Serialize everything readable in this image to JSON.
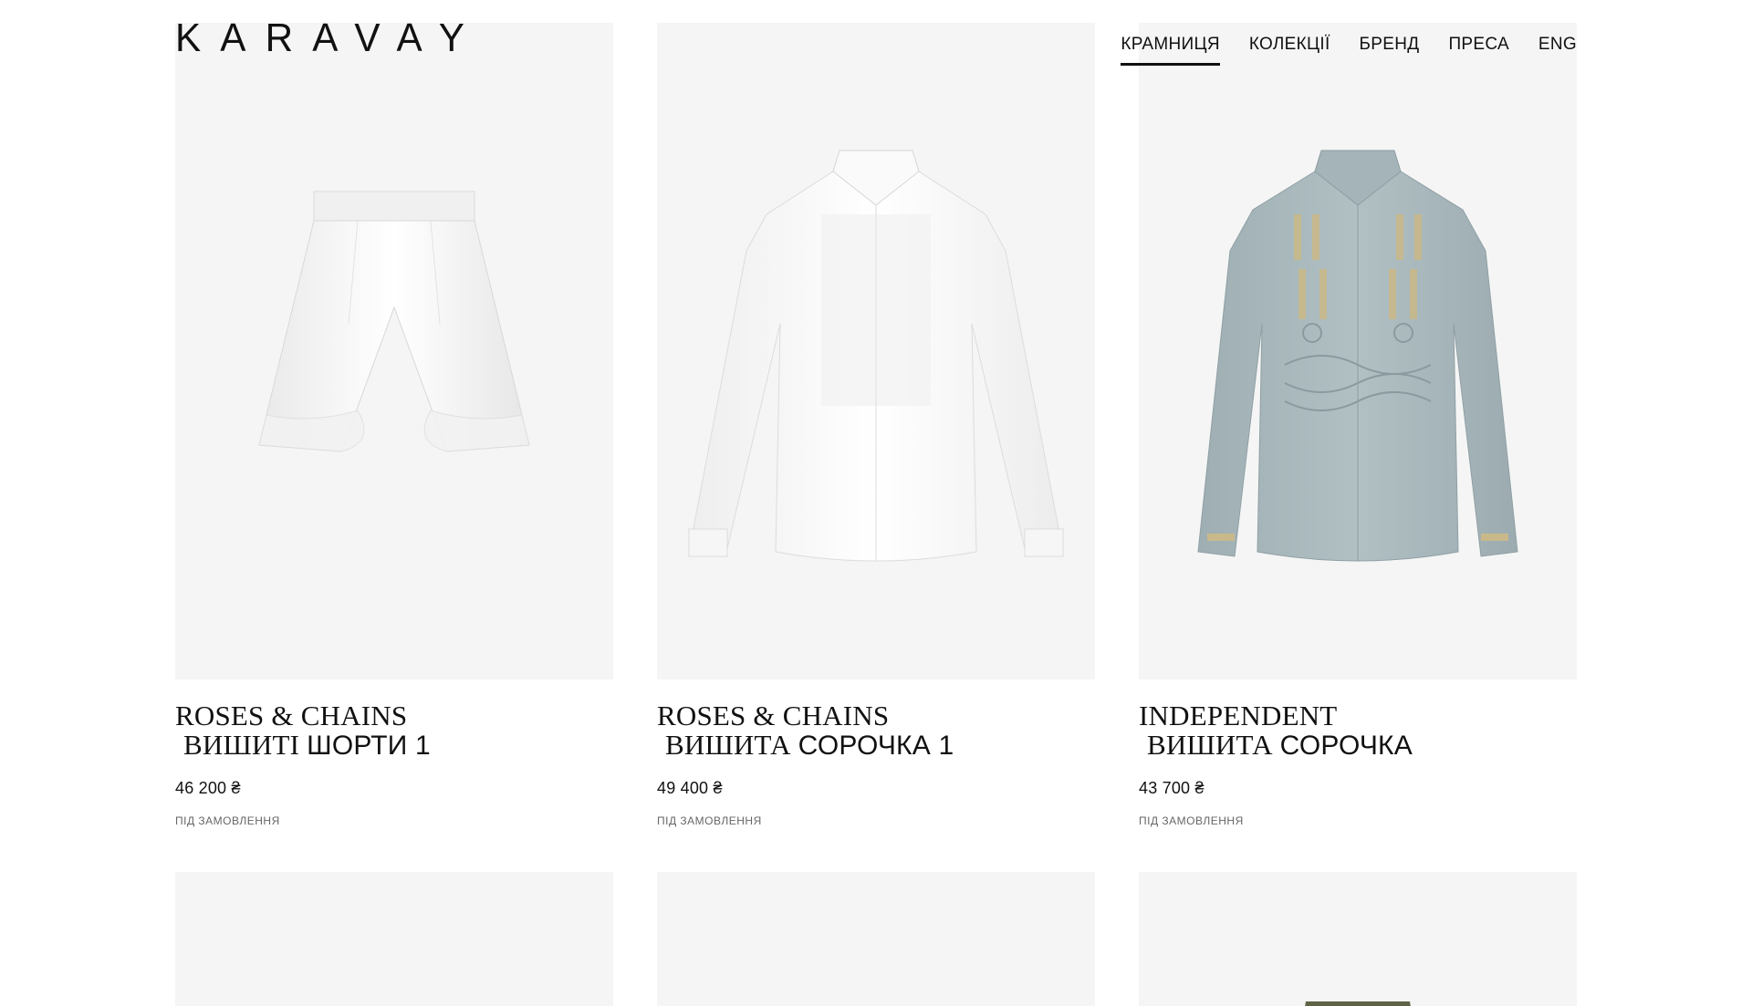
{
  "header": {
    "logo": "KARAVAY",
    "nav": [
      {
        "label": "КРАМНИЦЯ",
        "active": true
      },
      {
        "label": "КОЛЕКЦІЇ",
        "active": false
      },
      {
        "label": "БРЕНД",
        "active": false
      },
      {
        "label": "ПРЕСА",
        "active": false
      },
      {
        "label": "ENG",
        "active": false
      }
    ]
  },
  "products": [
    {
      "collection": "ROSES & CHAINS",
      "title_light": "ВИШИТІ",
      "title_bold": "ШОРТИ 1",
      "price": "46 200 ₴",
      "status": "ПІД ЗАМОВЛЕННЯ",
      "garment": "shorts",
      "color": "#ffffff"
    },
    {
      "collection": "ROSES & CHAINS",
      "title_light": "ВИШИТА",
      "title_bold": "СОРОЧКА 1",
      "price": "49 400 ₴",
      "status": "ПІД ЗАМОВЛЕННЯ",
      "garment": "shirt",
      "color": "#ffffff"
    },
    {
      "collection": "INDEPENDENT",
      "title_light": "ВИШИТА",
      "title_bold": "СОРОЧКА",
      "price": "43 700 ₴",
      "status": "ПІД ЗАМОВЛЕННЯ",
      "garment": "shirt",
      "color": "#a8b7bb"
    }
  ],
  "next_row": [
    {
      "garment": "none"
    },
    {
      "garment": "dark"
    },
    {
      "garment": "olive"
    }
  ],
  "colors": {
    "card_bg": "#f5f5f5",
    "text": "#111111",
    "status": "#666666"
  }
}
